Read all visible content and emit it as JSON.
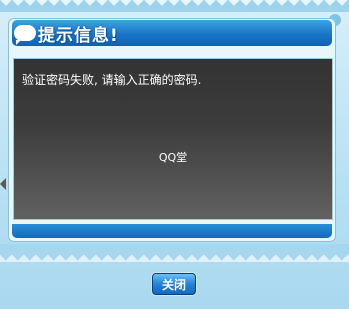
{
  "dialog": {
    "title": "提示信息!",
    "message": "验证密码失败, 请输入正确的密码.",
    "source": "QQ堂",
    "close_label": "关闭"
  },
  "colors": {
    "title_bar": "#1975c7",
    "message_bg": "#3c3c3c",
    "button": "#2383d6",
    "background": "#bfe3f5"
  },
  "icons": {
    "title": "speech-bubble-icon"
  }
}
